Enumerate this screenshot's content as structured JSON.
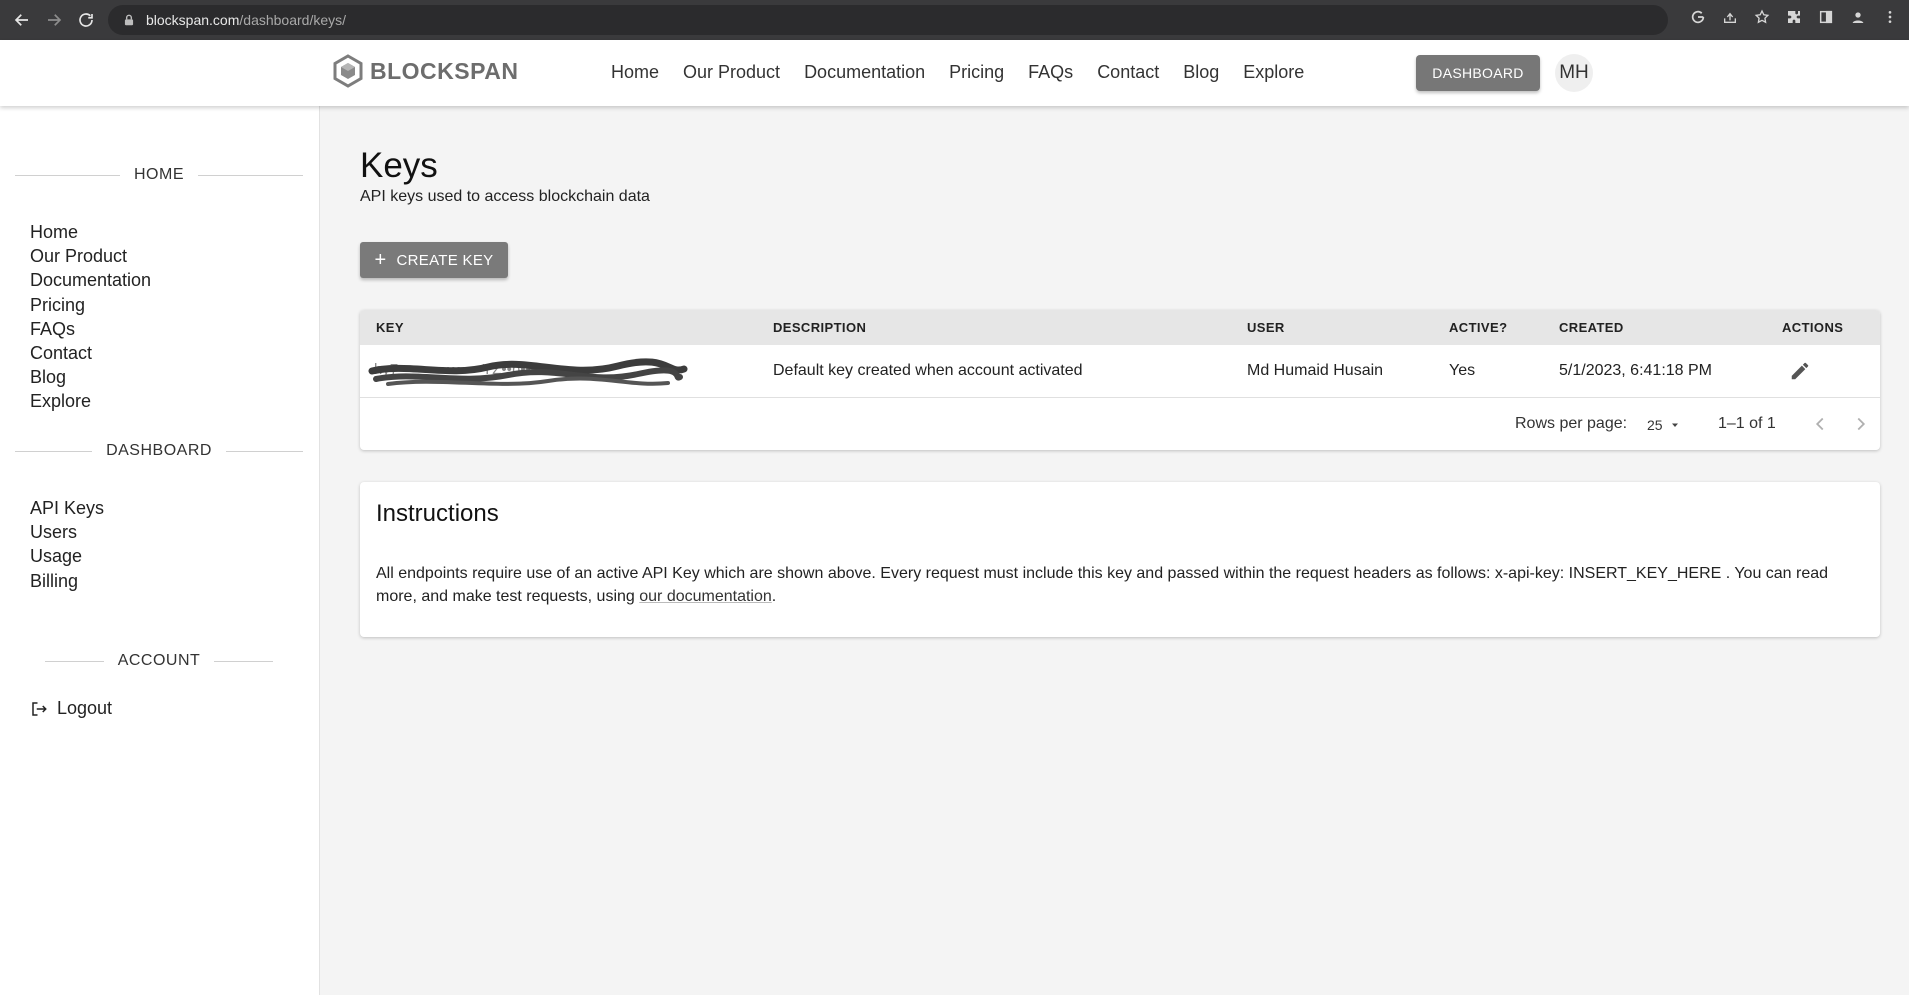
{
  "browser": {
    "url_host": "blockspan.com",
    "url_path": "/dashboard/keys/"
  },
  "header": {
    "brand": "BLOCKSPAN",
    "nav": [
      "Home",
      "Our Product",
      "Documentation",
      "Pricing",
      "FAQs",
      "Contact",
      "Blog",
      "Explore"
    ],
    "dashboard_button": "DASHBOARD",
    "avatar_initials": "MH"
  },
  "sidebar": {
    "home_heading": "HOME",
    "home_items": [
      "Home",
      "Our Product",
      "Documentation",
      "Pricing",
      "FAQs",
      "Contact",
      "Blog",
      "Explore"
    ],
    "dashboard_heading": "DASHBOARD",
    "dashboard_items": [
      "API Keys",
      "Users",
      "Usage",
      "Billing"
    ],
    "account_heading": "ACCOUNT",
    "logout_label": "Logout"
  },
  "main": {
    "title": "Keys",
    "subtitle": "API keys used to access blockchain data",
    "create_button": "CREATE KEY",
    "table": {
      "headers": {
        "key": "KEY",
        "description": "DESCRIPTION",
        "user": "USER",
        "active": "ACTIVE?",
        "created": "CREATED",
        "actions": "ACTIONS"
      },
      "rows": [
        {
          "key": "hy7••••••••••••••••YZ••b••••••",
          "description": "Default key created when account activated",
          "user": "Md Humaid Husain",
          "active": "Yes",
          "created": "5/1/2023, 6:41:18 PM"
        }
      ],
      "rows_per_page_label": "Rows per page:",
      "rows_per_page_value": "25",
      "range_label": "1–1 of 1"
    },
    "instructions": {
      "title": "Instructions",
      "body_before_link": "All endpoints require use of an active API Key which are shown above. Every request must include this key and passed within the request headers as follows: x-api-key: INSERT_KEY_HERE . You can read more, and make test requests, using ",
      "link_text": "our documentation",
      "body_after_link": "."
    }
  }
}
